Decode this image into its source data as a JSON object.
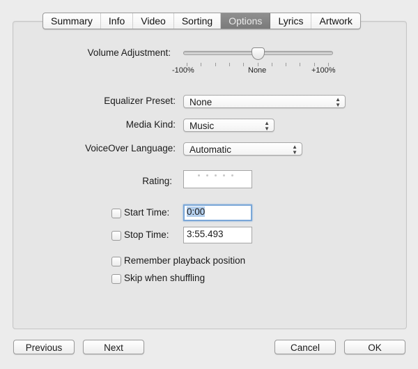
{
  "tabs": [
    {
      "label": "Summary",
      "active": false
    },
    {
      "label": "Info",
      "active": false
    },
    {
      "label": "Video",
      "active": false
    },
    {
      "label": "Sorting",
      "active": false
    },
    {
      "label": "Options",
      "active": true
    },
    {
      "label": "Lyrics",
      "active": false
    },
    {
      "label": "Artwork",
      "active": false
    }
  ],
  "volume": {
    "label": "Volume Adjustment:",
    "min_label": "-100%",
    "mid_label": "None",
    "max_label": "+100%",
    "value_percent": 0,
    "tick_count": 11
  },
  "equalizer": {
    "label": "Equalizer Preset:",
    "value": "None"
  },
  "media_kind": {
    "label": "Media Kind:",
    "value": "Music"
  },
  "voiceover": {
    "label": "VoiceOver Language:",
    "value": "Automatic"
  },
  "rating": {
    "label": "Rating:",
    "value": 0,
    "max": 5
  },
  "start_time": {
    "label": "Start Time:",
    "checked": false,
    "value": "0:00"
  },
  "stop_time": {
    "label": "Stop Time:",
    "checked": false,
    "value": "3:55.493"
  },
  "remember_position": {
    "label": "Remember playback position",
    "checked": false
  },
  "skip_shuffling": {
    "label": "Skip when shuffling",
    "checked": false
  },
  "buttons": {
    "previous": "Previous",
    "next": "Next",
    "cancel": "Cancel",
    "ok": "OK"
  },
  "icons": {
    "select_arrows": "▲▼"
  }
}
